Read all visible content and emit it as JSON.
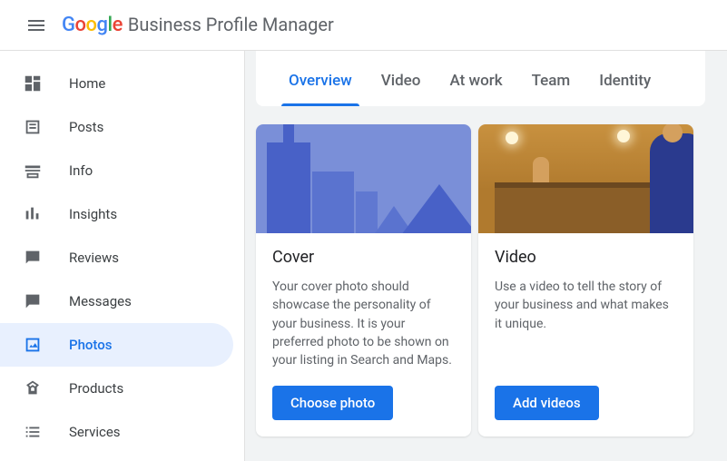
{
  "header": {
    "product": "Business Profile Manager"
  },
  "sidebar": {
    "items": [
      {
        "label": "Home"
      },
      {
        "label": "Posts"
      },
      {
        "label": "Info"
      },
      {
        "label": "Insights"
      },
      {
        "label": "Reviews"
      },
      {
        "label": "Messages"
      },
      {
        "label": "Photos"
      },
      {
        "label": "Products"
      },
      {
        "label": "Services"
      }
    ]
  },
  "tabs": [
    {
      "label": "Overview"
    },
    {
      "label": "Video"
    },
    {
      "label": "At work"
    },
    {
      "label": "Team"
    },
    {
      "label": "Identity"
    }
  ],
  "cards": {
    "cover": {
      "title": "Cover",
      "desc": "Your cover photo should showcase the personality of your business. It is your preferred photo to be shown on your listing in Search and Maps.",
      "button": "Choose photo"
    },
    "video": {
      "title": "Video",
      "desc": "Use a video to tell the story of your business and what makes it unique.",
      "button": "Add videos"
    }
  }
}
